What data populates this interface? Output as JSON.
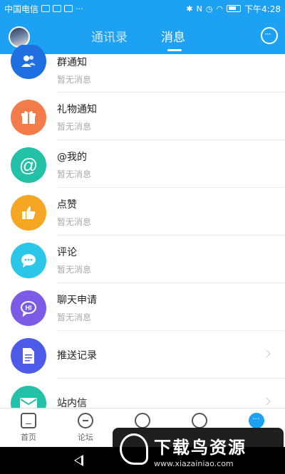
{
  "status_bar": {
    "carrier": "中国电信",
    "time": "下午4:28",
    "more": "···"
  },
  "header": {
    "tabs": [
      {
        "label": "通讯录",
        "active": false
      },
      {
        "label": "消息",
        "active": true
      }
    ],
    "accent_color": "#1DA1F2"
  },
  "messages": [
    {
      "title": "群通知",
      "subtitle": "暂无消息",
      "icon": "group-icon",
      "color": "#1E6FE0"
    },
    {
      "title": "礼物通知",
      "subtitle": "暂无消息",
      "icon": "gift-icon",
      "color": "#F47B4A"
    },
    {
      "title": "@我的",
      "subtitle": "暂无消息",
      "icon": "at-icon",
      "color": "#22C1A8"
    },
    {
      "title": "点赞",
      "subtitle": "暂无消息",
      "icon": "thumbs-up-icon",
      "color": "#F5A623"
    },
    {
      "title": "评论",
      "subtitle": "暂无消息",
      "icon": "comment-icon",
      "color": "#2CC6E8"
    },
    {
      "title": "聊天申请",
      "subtitle": "暂无消息",
      "icon": "chat-request-icon",
      "color": "#7B5CE6"
    },
    {
      "title": "推送记录",
      "subtitle": "",
      "icon": "document-icon",
      "color": "#4E5BE8"
    },
    {
      "title": "站内信",
      "subtitle": "",
      "icon": "mail-icon",
      "color": "#22C1A8"
    }
  ],
  "bottom_nav": [
    {
      "label": "首页",
      "icon": "home-icon"
    },
    {
      "label": "论坛",
      "icon": "forum-icon"
    },
    {
      "label": "",
      "icon": "refresh-icon"
    },
    {
      "label": "",
      "icon": "eye-icon"
    },
    {
      "label": "",
      "icon": "more-icon",
      "active": true
    }
  ],
  "watermark": {
    "title": "下载鸟资源",
    "url": "www.xiazainiao.com"
  }
}
